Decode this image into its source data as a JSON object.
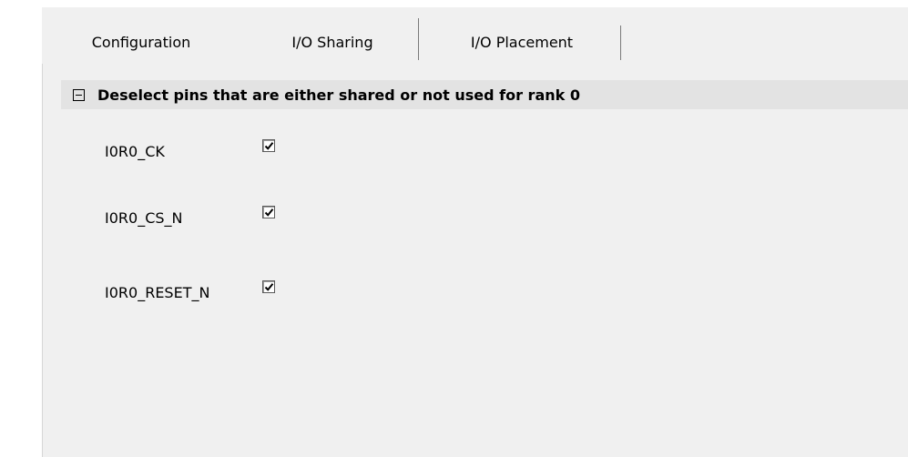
{
  "tabs": [
    {
      "label": "Configuration",
      "active": false
    },
    {
      "label": "I/O Sharing",
      "active": true
    },
    {
      "label": "I/O Placement",
      "active": false
    }
  ],
  "section": {
    "title": "Deselect pins that are either shared or not used for rank 0",
    "toggle_icon": "collapse-minus-icon"
  },
  "pins": [
    {
      "label": "I0R0_CK",
      "checked": true
    },
    {
      "label": "I0R0_CS_N",
      "checked": true
    },
    {
      "label": "I0R0_RESET_N",
      "checked": true
    }
  ]
}
